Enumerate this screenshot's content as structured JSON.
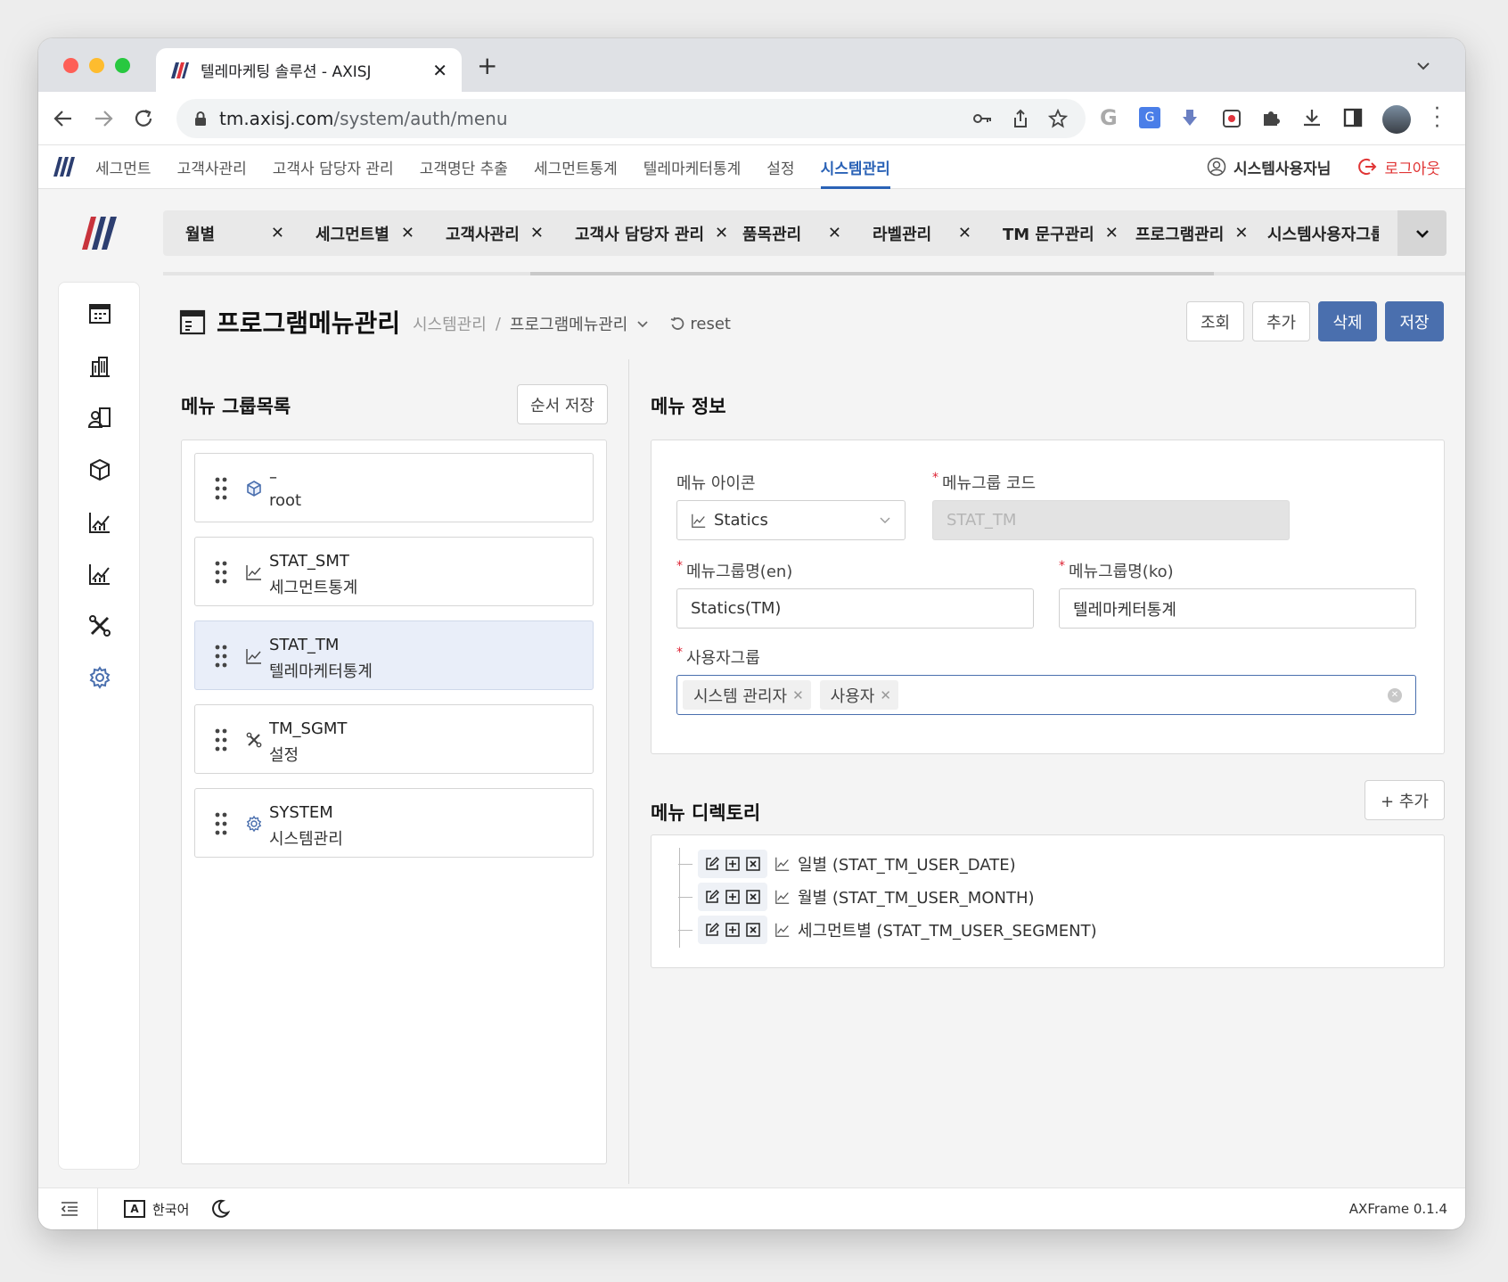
{
  "browser": {
    "tab_title": "텔레마케팅 솔루션 - AXISJ",
    "url_host": "tm.axisj.com",
    "url_path": "/system/auth/menu"
  },
  "nav": {
    "items": [
      "세그먼트",
      "고객사관리",
      "고객사 담당자 관리",
      "고객명단 추출",
      "세그먼트통계",
      "텔레마케터통계",
      "설정",
      "시스템관리"
    ],
    "active_index": 7,
    "user_label": "시스템사용자님",
    "logout_label": "로그아웃"
  },
  "page_tabs": [
    "월별",
    "세그먼트별",
    "고객사관리",
    "고객사 담당자 관리",
    "품목관리",
    "라벨관리",
    "TM 문구관리",
    "프로그램관리",
    "시스템사용자그룹 관리"
  ],
  "sidebar_icons": [
    "calendar-icon",
    "building-icon",
    "user-badge-icon",
    "cube-icon",
    "chart-icon",
    "chart-icon",
    "tools-icon",
    "gear-icon"
  ],
  "header": {
    "title": "프로그램메뉴관리",
    "breadcrumb_root": "시스템관리",
    "breadcrumb_sep": "/",
    "breadcrumb_current": "프로그램메뉴관리",
    "reset_label": "reset",
    "btn_search": "조회",
    "btn_add": "추가",
    "btn_delete": "삭제",
    "btn_save": "저장"
  },
  "group_list": {
    "title": "메뉴 그룹목록",
    "order_save": "순서 저장",
    "items": [
      {
        "code": "–",
        "name": "root",
        "icon": "cube-icon"
      },
      {
        "code": "STAT_SMT",
        "name": "세그먼트통계",
        "icon": "chart-icon"
      },
      {
        "code": "STAT_TM",
        "name": "텔레마케터통계",
        "icon": "chart-icon",
        "selected": true
      },
      {
        "code": "TM_SGMT",
        "name": "설정",
        "icon": "tools-icon"
      },
      {
        "code": "SYSTEM",
        "name": "시스템관리",
        "icon": "gear-icon"
      }
    ]
  },
  "menu_info": {
    "title": "메뉴 정보",
    "icon_label": "메뉴 아이콘",
    "icon_value": "Statics",
    "code_label": "메뉴그룹 코드",
    "code_value": "STAT_TM",
    "name_en_label": "메뉴그룹명(en)",
    "name_en_value": "Statics(TM)",
    "name_ko_label": "메뉴그룹명(ko)",
    "name_ko_value": "텔레마케터통계",
    "user_group_label": "사용자그룹",
    "user_groups": [
      "시스템 관리자",
      "사용자"
    ]
  },
  "menu_dir": {
    "title": "메뉴 디렉토리",
    "add_label": "+ 추가",
    "items": [
      "일별 (STAT_TM_USER_DATE)",
      "월별 (STAT_TM_USER_MONTH)",
      "세그먼트별 (STAT_TM_USER_SEGMENT)"
    ]
  },
  "footer": {
    "language": "한국어",
    "version": "AXFrame 0.1.4"
  },
  "colors": {
    "accent": "#4a6fae",
    "nav_active": "#2a62b6",
    "logout": "#e03535"
  }
}
